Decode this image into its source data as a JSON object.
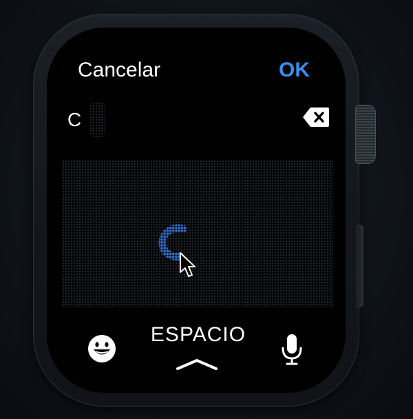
{
  "header": {
    "cancel_label": "Cancelar",
    "ok_label": "OK"
  },
  "input": {
    "value": "C"
  },
  "keyboard": {
    "space_label": "ESPACIO"
  },
  "icons": {
    "delete": "delete-backspace-icon",
    "emoji": "emoji-smiley-icon",
    "expand": "chevron-up-icon",
    "mic": "microphone-icon",
    "pointer": "mouse-pointer-icon"
  },
  "colors": {
    "accent": "#3a8ef0",
    "stroke": "#2f6fd8"
  }
}
